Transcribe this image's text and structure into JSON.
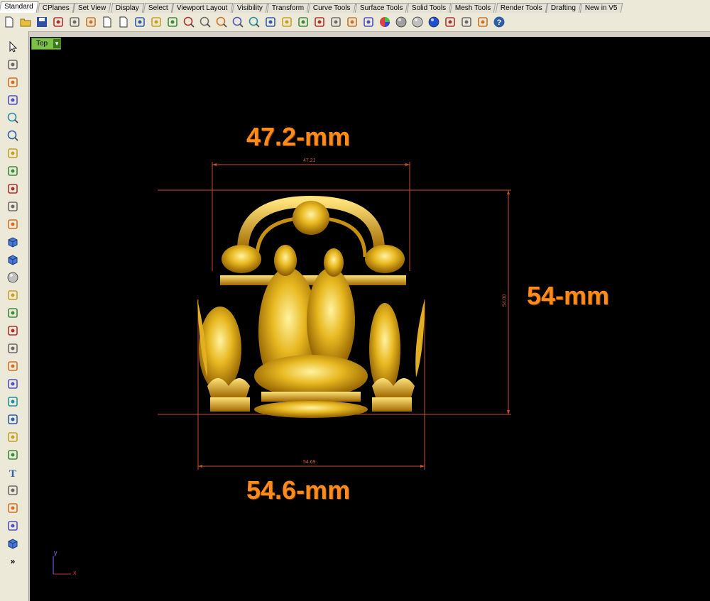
{
  "tabs": [
    "Standard",
    "CPlanes",
    "Set View",
    "Display",
    "Select",
    "Viewport Layout",
    "Visibility",
    "Transform",
    "Curve Tools",
    "Surface Tools",
    "Solid Tools",
    "Mesh Tools",
    "Render Tools",
    "Drafting",
    "New in V5"
  ],
  "toolbar_icons": [
    "new-icon",
    "open-icon",
    "save-icon",
    "print-icon",
    "import-icon",
    "cut-icon",
    "copy-icon",
    "paste-icon",
    "undo-icon",
    "pan-hand-icon",
    "rotate-view-icon",
    "zoom-icon",
    "zoom-window-icon",
    "zoom-extents-icon",
    "zoom-selected-icon",
    "zoom-previous-icon",
    "four-views-icon",
    "car-icon",
    "hide-icon",
    "show-icon",
    "light-icon",
    "lock-icon",
    "layer-icon",
    "color-wheel-icon",
    "sphere-gray-icon",
    "sphere-shaded-icon",
    "sphere-blue-icon",
    "flag-icon",
    "settings-icon",
    "properties-icon",
    "help-icon"
  ],
  "left_tools": [
    "select-arrow-icon",
    "point-icon",
    "polyline-icon",
    "curve-icon",
    "circle-icon",
    "ellipse-icon",
    "polygon-icon",
    "rectangle-icon",
    "arc-icon",
    "fillet-icon",
    "surface-icon",
    "extrude-icon",
    "box-icon",
    "spheres-icon",
    "surface-loft-icon",
    "mesh-icon",
    "points-icon",
    "explode-icon",
    "trim-icon",
    "split-icon",
    "boolean-icon",
    "array-icon",
    "move-icon",
    "rotate-icon",
    "text-icon",
    "dimension-icon",
    "group-icon",
    "block-icon",
    "render-icon",
    "more-icon"
  ],
  "viewport": {
    "name": "Top",
    "width_label": "47.2-mm",
    "height_label": "54-mm",
    "bottom_label": "54.6-mm",
    "dim_top_small": "47.21",
    "dim_right_small": "54.00",
    "dim_bottom_small": "54.69",
    "axis_x": "x",
    "axis_y": "y"
  },
  "colors": {
    "viewport_bg": "#000000",
    "dimension_text": "#ff8c1a",
    "dimension_line": "#c8502a",
    "model_gold": "#d4a017"
  },
  "more_label": "»"
}
